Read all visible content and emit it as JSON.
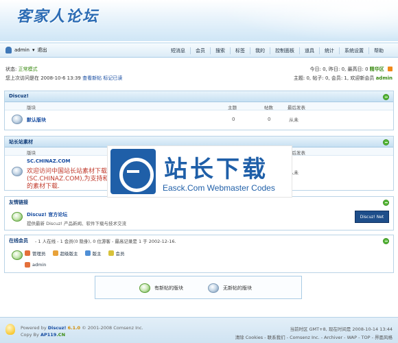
{
  "header": {
    "logo_text": "客家人论坛"
  },
  "nav": {
    "username": "admin",
    "logout": "退出",
    "menu": [
      "短消息",
      "会员",
      "搜索",
      "帮助",
      "标签",
      "我的",
      "控制面板",
      "道具",
      "统计",
      "系统设置",
      "帮助"
    ]
  },
  "status": {
    "mode_label": "状态:",
    "mode_value": "正常模式",
    "last_visit": "您上次访问是在 2008-10-6 13:39",
    "new_posts": "查看新帖",
    "mark_read": "标记已读",
    "stats_today": "今日: 0, 昨日: 0, 最高日: 0",
    "digest": "精华区",
    "stats_total": "主题: 0, 帖子: 0, 会员: 1, 欢迎新会员",
    "newest_member": "admin"
  },
  "panels": {
    "discuz": {
      "title": "Discuz!",
      "cols": {
        "forum": "版块",
        "topics": "主题",
        "posts": "帖数",
        "last": "最后发表"
      },
      "row": {
        "name": "默认版块",
        "topics": "0",
        "posts": "0",
        "last": "从未"
      }
    },
    "station": {
      "title": "站长站素材",
      "cols": {
        "forum": "版块",
        "last": "最后发表"
      },
      "row": {
        "name": "SC.CHINAZ.COM",
        "desc1": "欢迎访问中国站长站素材下载",
        "desc2": "(SC.CHINAZ.COM),为支持和",
        "desc3": "的素材下载.",
        "last": "从未"
      }
    },
    "links": {
      "title": "友情链接",
      "name": "Discuz! 官方论坛",
      "desc": "提供最新 Discuz! 产品新闻、软件下载与技术交流",
      "badge": "Discuz! Net"
    },
    "online": {
      "title": "在线会员",
      "summary": "- 1 人在线 - 1 会员(0 隐身), 0 位游客 - 最高记录是 1 于 2002-12-16.",
      "legend": [
        "管理员",
        "超级版主",
        "版主",
        "会员"
      ],
      "user": "admin"
    }
  },
  "legend_box": {
    "new": "有新帖的版块",
    "none": "无新帖的版块"
  },
  "watermark": {
    "title": "站长下载",
    "subtitle": "Easck.Com Webmaster Codes"
  },
  "footer": {
    "powered_prefix": "Powered by",
    "product": "Discuz!",
    "version": "6.1.0",
    "copyright": "© 2001-2008 Comsenz Inc.",
    "copy_by_prefix": "Copy By",
    "copy_by": "AP119",
    "copy_by_suffix": ".CN",
    "timezone": "当前时区 GMT+8, 现在时间是 2008-10-14 13:44",
    "links": "清除 Cookies - 联系我们 - Comsenz Inc. - Archiver - WAP - TOP - 界面风格"
  },
  "colors": {
    "accent": "#154ba0",
    "green": "#3a8a12",
    "watermark": "#1f5fa8"
  }
}
